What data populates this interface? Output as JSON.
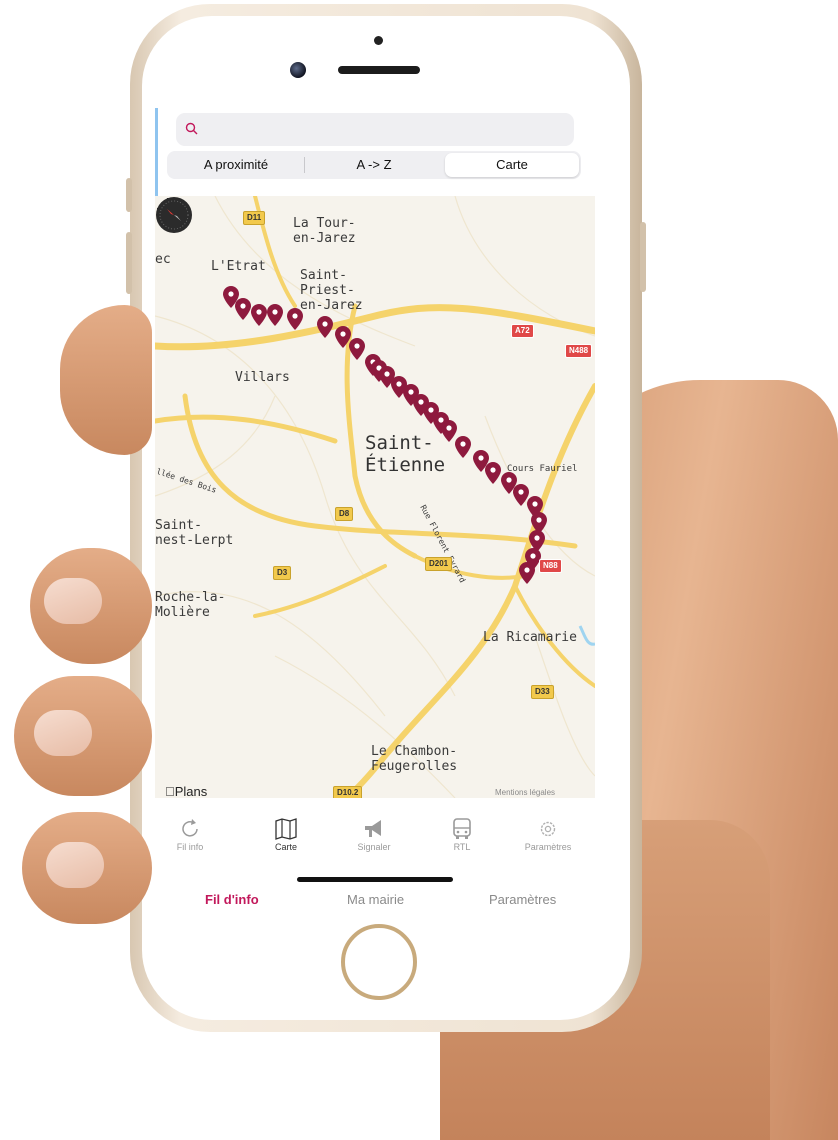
{
  "search": {
    "placeholder": ""
  },
  "segments": [
    {
      "label": "A proximité",
      "active": false
    },
    {
      "label": "A -> Z",
      "active": false
    },
    {
      "label": "Carte",
      "active": true
    }
  ],
  "map": {
    "places": {
      "tour_en_jarez": "La Tour-\nen-Jarez",
      "etrat": "L'Etrat",
      "saint_priest": "Saint-\nPriest-\nen-Jarez",
      "villars": "Villars",
      "saint_etienne": "Saint-\nÉtienne",
      "saint_genest": "Saint-\nnest-Lerpt",
      "roche_la_moliere": "Roche-la-\nMolière",
      "la_ricamarie": "La Ricamarie",
      "le_chambon": "Le Chambon-\nFeugerolles",
      "edge_ec": "ec",
      "cours_fauriel": "Cours Fauriel",
      "rue_evrard": "Rue Florent Evrard",
      "allee_des_bois": "llée des Bois"
    },
    "road_tags": {
      "d11": "D11",
      "a72": "A72",
      "n488": "N488",
      "d8": "D8",
      "d201": "D201",
      "n88": "N88",
      "d3": "D3",
      "d33": "D33",
      "d10_2": "D10.2"
    },
    "attribution": "Plans",
    "legal": "Mentions légales",
    "marker_color": "#8e1a3e",
    "road_color": "#f5d36b"
  },
  "tabbar": [
    {
      "label": "Fil info",
      "icon": "refresh-icon",
      "active": false
    },
    {
      "label": "Carte",
      "icon": "map-icon",
      "active": true
    },
    {
      "label": "Signaler",
      "icon": "megaphone-icon",
      "active": false
    },
    {
      "label": "RTL",
      "icon": "bus-icon",
      "active": false
    },
    {
      "label": "Paramètres",
      "icon": "gear-icon",
      "active": false
    }
  ],
  "bottom_nav": [
    {
      "label": "Fil d'info",
      "active": true
    },
    {
      "label": "Ma mairie",
      "active": false
    },
    {
      "label": "Paramètres",
      "active": false
    }
  ],
  "colors": {
    "accent": "#c2185b",
    "segment_bg": "#efeff2"
  }
}
